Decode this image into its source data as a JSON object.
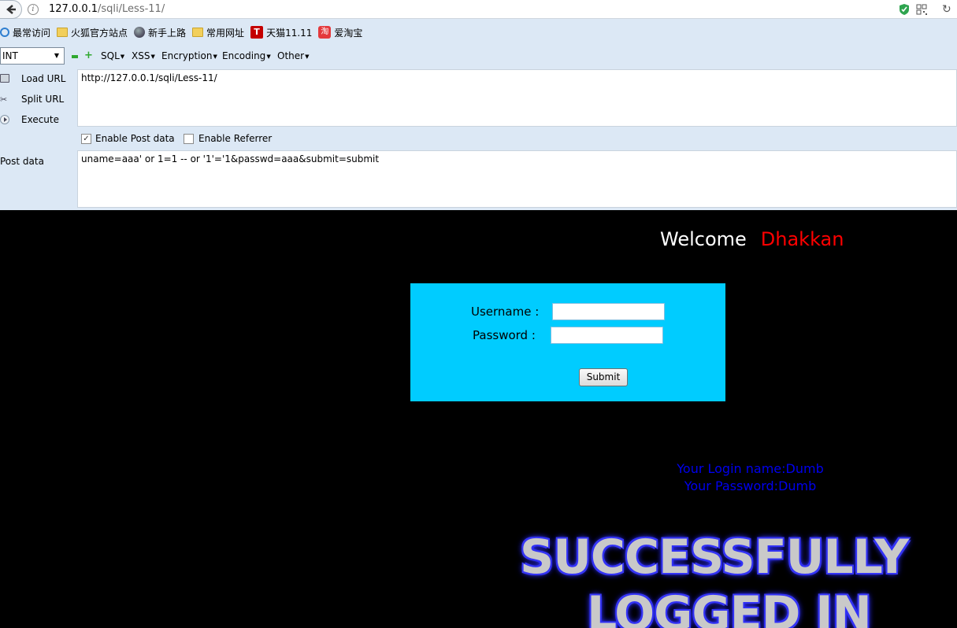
{
  "browser": {
    "url_host": "127.0.0.1",
    "url_path": "/sqli/Less-11/"
  },
  "bookmarks": [
    {
      "label": "最常访问",
      "icon": "search-icon"
    },
    {
      "label": "火狐官方站点",
      "icon": "folder-icon"
    },
    {
      "label": "新手上路",
      "icon": "globe-icon"
    },
    {
      "label": "常用网址",
      "icon": "folder-icon"
    },
    {
      "label": "天猫11.11",
      "icon": "tmall-icon"
    },
    {
      "label": "爱淘宝",
      "icon": "taobao-icon"
    }
  ],
  "hackbar": {
    "select_value": "INT",
    "menus": [
      "SQL",
      "XSS",
      "Encryption",
      "Encoding",
      "Other"
    ],
    "actions": {
      "load_url": "Load URL",
      "split_url": "Split URL",
      "execute": "Execute"
    },
    "url_value": "http://127.0.0.1/sqli/Less-11/",
    "enable_post_label": "Enable Post data",
    "enable_post_checked": true,
    "enable_referrer_label": "Enable Referrer",
    "enable_referrer_checked": false,
    "post_label": "Post data",
    "post_value": "uname=aaa' or 1=1 -- or '1'='1&passwd=aaa&submit=submit"
  },
  "page": {
    "welcome": "Welcome",
    "user_name": "Dhakkan",
    "form": {
      "username_label": "Username :",
      "password_label": "Password :",
      "submit_label": "Submit"
    },
    "login_name_line": "Your Login name:Dumb",
    "password_line": "Your Password:Dumb",
    "banner_line1": "SUCCESSFULLY",
    "banner_line2": "LOGGED IN"
  },
  "colors": {
    "toolbar_bg": "#dce8f5",
    "form_bg": "#00ccff",
    "accent_red": "#ff0000",
    "result_blue": "#0000ee"
  }
}
